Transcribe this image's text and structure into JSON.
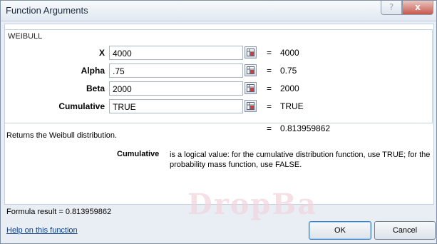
{
  "window": {
    "title": "Function Arguments",
    "help_glyph": "?",
    "close_glyph": "x"
  },
  "function_name": "WEIBULL",
  "arguments": [
    {
      "label": "X",
      "value": "4000",
      "evaluated": "4000"
    },
    {
      "label": "Alpha",
      "value": ".75",
      "evaluated": "0.75"
    },
    {
      "label": "Beta",
      "value": "2000",
      "evaluated": "2000"
    },
    {
      "label": "Cumulative",
      "value": "TRUE",
      "evaluated": "TRUE"
    }
  ],
  "equals": "=",
  "result_value": "0.813959862",
  "description": "Returns the Weibull distribution.",
  "arg_help": {
    "name": "Cumulative",
    "text": "is a logical value: for the cumulative distribution function, use TRUE; for the probability mass function, use FALSE."
  },
  "formula_result": {
    "label": "Formula result =",
    "value": "0.813959862"
  },
  "help_link": "Help on this function",
  "buttons": {
    "ok": "OK",
    "cancel": "Cancel"
  },
  "watermark_text": "DropBa"
}
